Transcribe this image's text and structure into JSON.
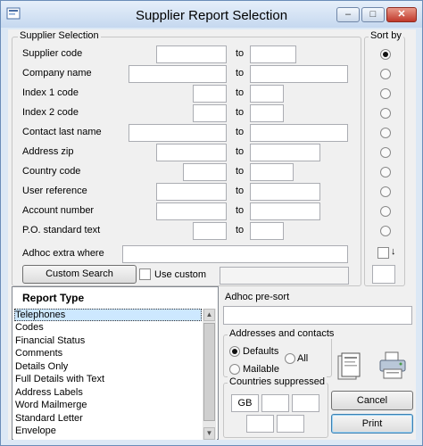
{
  "window": {
    "title": "Supplier Report Selection"
  },
  "supplier_selection": {
    "title": "Supplier Selection",
    "to_label": "to",
    "rows": [
      {
        "label": "Supplier code"
      },
      {
        "label": "Company name"
      },
      {
        "label": "Index 1 code"
      },
      {
        "label": "Index 2 code"
      },
      {
        "label": "Contact last name"
      },
      {
        "label": "Address zip"
      },
      {
        "label": "Country code"
      },
      {
        "label": "User reference"
      },
      {
        "label": "Account number"
      },
      {
        "label": "P.O. standard text"
      }
    ],
    "adhoc_label": "Adhoc extra where",
    "custom_search_label": "Custom Search",
    "use_custom_label": "Use custom"
  },
  "sort_by": {
    "title": "Sort by",
    "selected_index": 0,
    "down_arrow": "↓"
  },
  "report_type": {
    "title": "Report Type",
    "items": [
      "Telephones",
      "Codes",
      "Financial Status",
      "Comments",
      "Details Only",
      "Full Details with Text",
      "Address Labels",
      "Word Mailmerge",
      "Standard Letter",
      "Envelope"
    ],
    "selected_index": 0
  },
  "adhoc_presort": {
    "label": "Adhoc pre-sort"
  },
  "addresses_contacts": {
    "title": "Addresses and contacts",
    "options": [
      "Defaults",
      "All",
      "Mailable"
    ],
    "selected": "Defaults"
  },
  "countries_suppressed": {
    "title": "Countries suppressed",
    "values": [
      "GB",
      "",
      "",
      "",
      "",
      ""
    ]
  },
  "buttons": {
    "cancel": "Cancel",
    "print": "Print"
  },
  "icons": {
    "app": "app-icon",
    "preview": "preview-icon",
    "printer": "printer-icon"
  }
}
